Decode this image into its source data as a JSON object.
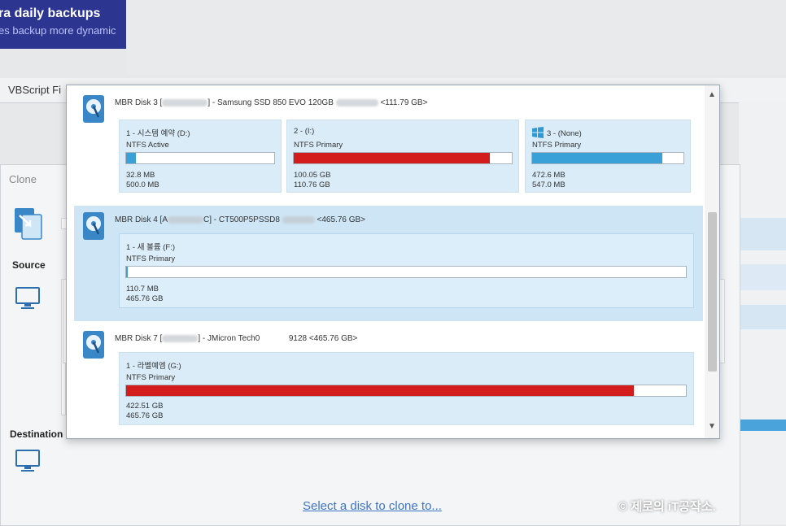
{
  "banner": {
    "line1": "ra daily backups",
    "line2": "es backup more dynamic"
  },
  "menu": {
    "item1": "VBScript Fi"
  },
  "clone": {
    "title": "Clone",
    "source_label": "Source",
    "destination_label": "Destination",
    "select_link": "Select a disk to clone to..."
  },
  "watermark": "© 제로의 iT공작소.",
  "colors": {
    "used_red": "#d31c1c",
    "used_blue": "#3aa0d8",
    "selected_row": "#cde5f5",
    "link": "#3d74c8"
  },
  "disks": [
    {
      "prefix": "MBR Disk 3 [",
      "middle": "] - Samsung SSD 850 EVO 120GB",
      "suffix": "<111.79 GB>",
      "selected": false,
      "partitions": [
        {
          "name": "1 - 시스템 예약 (D:)",
          "type": "NTFS Active",
          "used": "32.8 MB",
          "total": "500.0 MB",
          "fill": 0.066,
          "color": "blue",
          "icon": ""
        },
        {
          "name": "2 - (I:)",
          "type": "NTFS Primary",
          "used": "100.05 GB",
          "total": "110.76 GB",
          "fill": 0.9,
          "color": "red",
          "icon": ""
        },
        {
          "name": "3 - (None)",
          "type": "NTFS Primary",
          "used": "472.6 MB",
          "total": "547.0 MB",
          "fill": 0.86,
          "color": "blue",
          "icon": "windows-icon"
        }
      ]
    },
    {
      "prefix": "MBR Disk 4 [A",
      "middle": "C] - CT500P5PSSD8",
      "suffix": "<465.76 GB>",
      "selected": true,
      "partitions": [
        {
          "name": "1 - 새 볼륨 (F:)",
          "type": "NTFS Primary",
          "used": "110.7 MB",
          "total": "465.76 GB",
          "fill": 0.0002,
          "color": "blue",
          "icon": ""
        }
      ]
    },
    {
      "prefix": "MBR Disk 7 [",
      "middle": "] - JMicron  Tech0",
      "extra": "9128",
      "suffix": "<465.76 GB>",
      "selected": false,
      "partitions": [
        {
          "name": "1 - 라벨예엠 (G:)",
          "type": "NTFS Primary",
          "used": "422.51 GB",
          "total": "465.76 GB",
          "fill": 0.907,
          "color": "red",
          "icon": ""
        }
      ]
    }
  ]
}
